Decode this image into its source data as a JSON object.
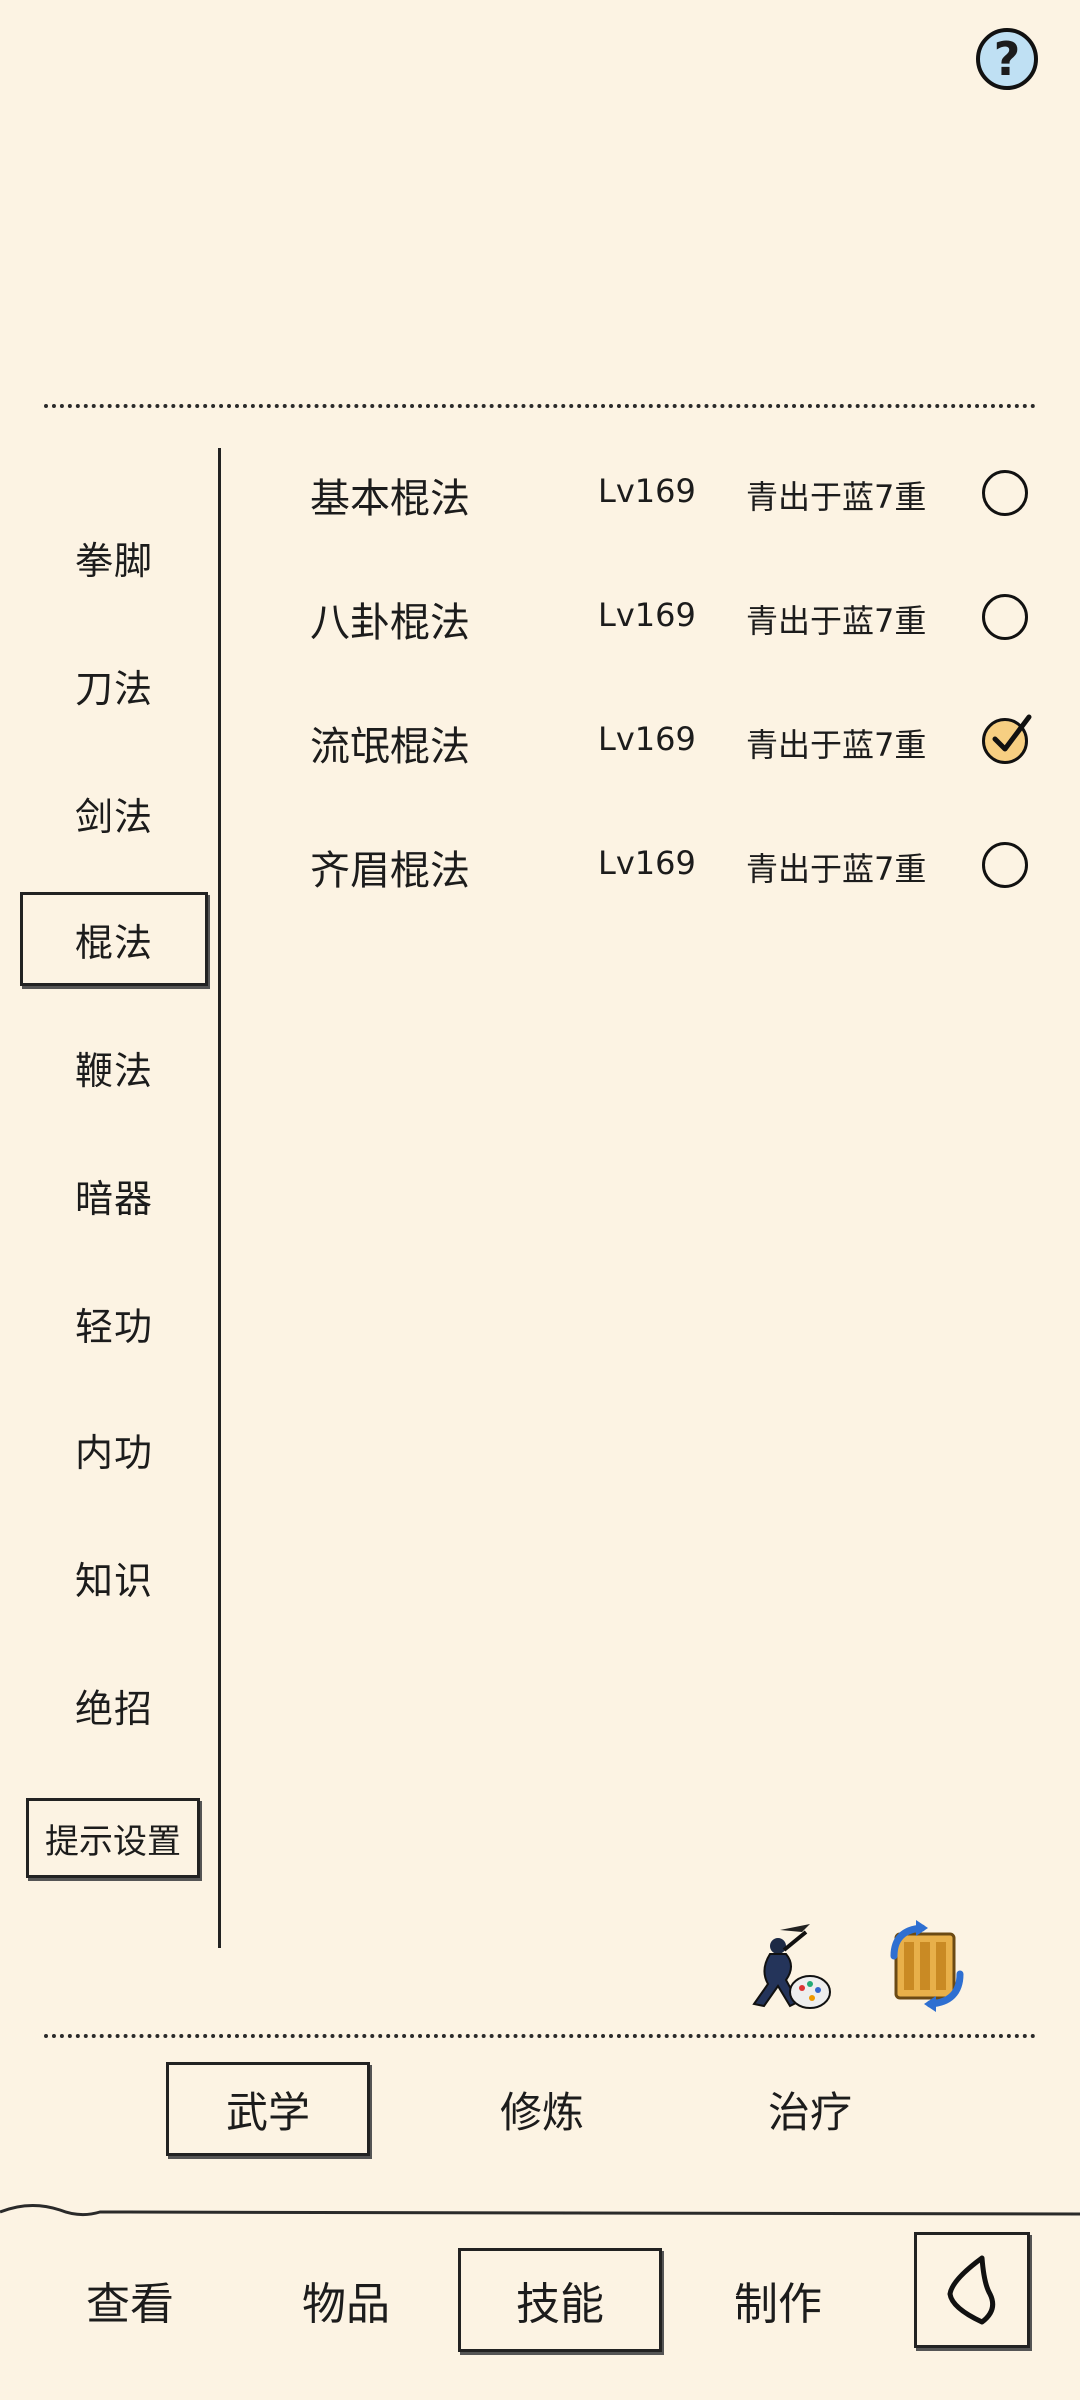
{
  "header": {
    "help_icon": "question-mark-icon",
    "help_label": "?"
  },
  "categories": [
    {
      "label": "拳脚",
      "active": false
    },
    {
      "label": "刀法",
      "active": false
    },
    {
      "label": "剑法",
      "active": false
    },
    {
      "label": "棍法",
      "active": true
    },
    {
      "label": "鞭法",
      "active": false
    },
    {
      "label": "暗器",
      "active": false
    },
    {
      "label": "轻功",
      "active": false
    },
    {
      "label": "内功",
      "active": false
    },
    {
      "label": "知识",
      "active": false
    },
    {
      "label": "绝招",
      "active": false
    }
  ],
  "hint_settings_label": "提示设置",
  "skills": [
    {
      "name": "基本棍法",
      "level": "Lv169",
      "rank": "青出于蓝7重",
      "checked": false
    },
    {
      "name": "八卦棍法",
      "level": "Lv169",
      "rank": "青出于蓝7重",
      "checked": false
    },
    {
      "name": "流氓棍法",
      "level": "Lv169",
      "rank": "青出于蓝7重",
      "checked": true
    },
    {
      "name": "齐眉棍法",
      "level": "Lv169",
      "rank": "青出于蓝7重",
      "checked": false
    }
  ],
  "tool_icons": [
    "martial-artist-palette-icon",
    "scroll-exchange-icon"
  ],
  "sub_tabs": [
    {
      "label": "武学",
      "active": true
    },
    {
      "label": "修炼",
      "active": false
    },
    {
      "label": "治疗",
      "active": false
    }
  ],
  "nav_tabs": [
    {
      "label": "查看",
      "active": false
    },
    {
      "label": "物品",
      "active": false
    },
    {
      "label": "技能",
      "active": true
    },
    {
      "label": "制作",
      "active": false
    }
  ],
  "back_icon": "back-arrow-icon",
  "colors": {
    "background": "#fcf3e3",
    "ink": "#1c1c1c",
    "check_fill": "#f7cf82",
    "help_fill": "#bfe0f3"
  }
}
